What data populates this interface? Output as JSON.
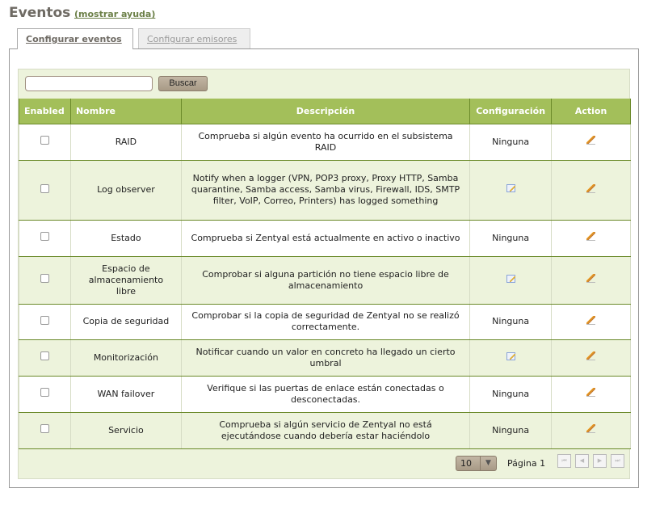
{
  "header": {
    "title": "Eventos",
    "help_link": "(mostrar ayuda)"
  },
  "tabs": [
    {
      "label": "Configurar eventos",
      "active": true
    },
    {
      "label": "Configurar emisores",
      "active": false
    }
  ],
  "search": {
    "value": "",
    "placeholder": "",
    "button": "Buscar"
  },
  "table": {
    "columns": [
      "Enabled",
      "Nombre",
      "Descripción",
      "Configuración",
      "Action"
    ],
    "rows": [
      {
        "name": "RAID",
        "description": "Comprueba si algún evento ha ocurrido en el subsistema RAID",
        "config": "Ninguna"
      },
      {
        "name": "Log observer",
        "description": "Notify when a logger (VPN, POP3 proxy, Proxy HTTP, Samba quarantine, Samba access, Samba virus, Firewall, IDS, SMTP filter, VoIP, Correo, Printers) has logged something",
        "config": ""
      },
      {
        "name": "Estado",
        "description": "Comprueba si Zentyal está actualmente en activo o inactivo",
        "config": "Ninguna"
      },
      {
        "name": "Espacio de almacenamiento libre",
        "description": "Comprobar si alguna partición no tiene espacio libre de almacenamiento",
        "config": ""
      },
      {
        "name": "Copia de seguridad",
        "description": "Comprobar si la copia de seguridad de Zentyal no se realizó correctamente.",
        "config": "Ninguna"
      },
      {
        "name": "Monitorización",
        "description": "Notificar cuando un valor en concreto ha llegado un cierto umbral",
        "config": ""
      },
      {
        "name": "WAN failover",
        "description": "Verifique si las puertas de enlace están conectadas o desconectadas.",
        "config": "Ninguna"
      },
      {
        "name": "Servicio",
        "description": "Comprueba si algún servicio de Zentyal no está ejecutándose cuando debería estar haciéndolo",
        "config": "Ninguna"
      }
    ]
  },
  "pager": {
    "page_size": "10",
    "page_label": "Página 1"
  }
}
